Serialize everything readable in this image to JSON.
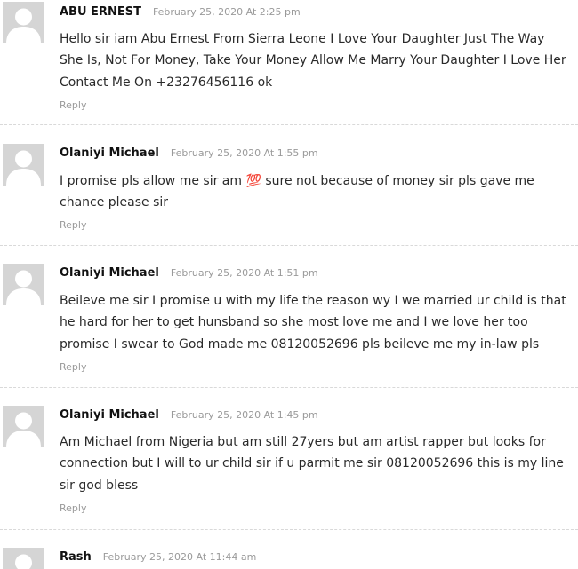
{
  "comments": [
    {
      "author": "ABU ERNEST",
      "date": "February 25, 2020 At 2:25 pm",
      "lines": [
        "Hello sir iam Abu Ernest From Sierra Leone I Love Your Daughter Just The Way",
        "She Is, Not For Money, Take Your Money Allow Me Marry Your Daughter I Love Her",
        "Contact Me On +23276456116 ok"
      ],
      "reply": "Reply"
    },
    {
      "author": "Olaniyi Michael",
      "date": "February 25, 2020 At 1:55 pm",
      "lines": [
        "I promise pls allow me sir am 💯 sure not because of money sir pls gave me",
        "chance please sir"
      ],
      "reply": "Reply"
    },
    {
      "author": "Olaniyi Michael",
      "date": "February 25, 2020 At 1:51 pm",
      "lines": [
        "Beileve me sir I promise u with my life the reason wy I we married ur child is that",
        "he hard for her to get hunsband so she most love me and I we love her too",
        "promise I swear to God made me 08120052696 pls beileve me my in-law pls"
      ],
      "reply": "Reply"
    },
    {
      "author": "Olaniyi Michael",
      "date": "February 25, 2020 At 1:45 pm",
      "lines": [
        "Am Michael from Nigeria but am still 27yers but am artist rapper but looks for",
        "connection but I will to ur child sir if u parmit me sir 08120052696 this is my line",
        "sir god bless"
      ],
      "reply": "Reply"
    },
    {
      "author": "Rash",
      "date": "February 25, 2020 At 11:44 am",
      "lines": [],
      "reply": ""
    }
  ]
}
